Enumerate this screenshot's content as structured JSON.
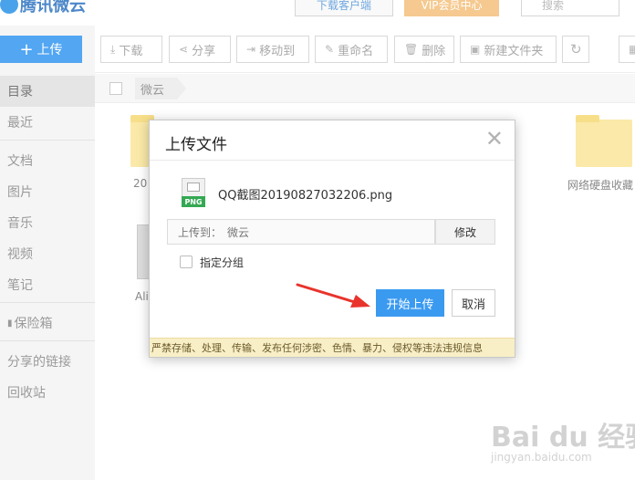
{
  "app": {
    "logo_text": "腾讯微云",
    "download_client": "下载客户端",
    "vip_center": "VIP会员中心",
    "search_placeholder": "搜索"
  },
  "sidebar": {
    "upload_label": "上传",
    "items": [
      {
        "label": "目录",
        "active": true
      },
      {
        "label": "最近"
      },
      {
        "label": "文档"
      },
      {
        "label": "图片"
      },
      {
        "label": "音乐"
      },
      {
        "label": "视频"
      },
      {
        "label": "笔记"
      },
      {
        "label": "保险箱"
      },
      {
        "label": "分享的链接"
      },
      {
        "label": "回收站"
      }
    ]
  },
  "toolbar": {
    "download": "下载",
    "share": "分享",
    "move_to": "移动到",
    "rename": "重命名",
    "delete": "删除",
    "new_folder": "新建文件夹"
  },
  "breadcrumb": {
    "root": "微云"
  },
  "files": {
    "label_partial_1": "20",
    "label_partial_2": "网络硬盘收藏",
    "label_partial_3": "Ali"
  },
  "dialog": {
    "title": "上传文件",
    "file_name": "QQ截图20190827032206.png",
    "file_type_tag": "PNG",
    "destination_label": "上传到：",
    "destination_value": "微云",
    "modify_button": "修改",
    "group_checkbox_label": "指定分组",
    "start_button": "开始上传",
    "cancel_button": "取消",
    "warning_text": "严禁存储、处理、传输、发布任何涉密、色情、暴力、侵权等违法违规信息"
  },
  "watermark": {
    "brand": "Bai du 经验",
    "url": "jingyan.baidu.com"
  },
  "colors": {
    "primary": "#3a9af0",
    "upload_button": "#52a6f2",
    "folder": "#fae9a8",
    "warning_bg": "#f8efc7",
    "arrow": "#e8342c"
  }
}
